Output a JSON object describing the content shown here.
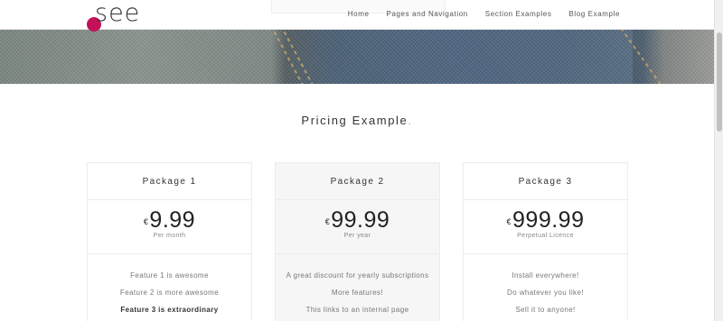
{
  "logo": {
    "text": "see",
    "accent_color": "#c4125a"
  },
  "nav": {
    "items": [
      "Home",
      "Pages and Navigation",
      "Section Examples",
      "Blog Example"
    ]
  },
  "section": {
    "title": "Pricing Example",
    "dot": ".",
    "dot_color": "#e0b03a"
  },
  "packages": [
    {
      "name": "Package 1",
      "currency": "€",
      "price": "9.99",
      "period": "Per month",
      "features": [
        "Feature 1 is awesome",
        "Feature 2 is more awesome",
        "Feature 3 is extraordinary"
      ]
    },
    {
      "name": "Package 2",
      "currency": "€",
      "price": "99.99",
      "period": "Per year",
      "features": [
        "A great discount for yearly subscriptions",
        "More features!",
        "This links to an internal page"
      ]
    },
    {
      "name": "Package 3",
      "currency": "€",
      "price": "999.99",
      "period": "Perpetual Licence",
      "features": [
        "Install everywhere!",
        "Do whatever you like!",
        "Sell it to anyone!"
      ]
    }
  ]
}
